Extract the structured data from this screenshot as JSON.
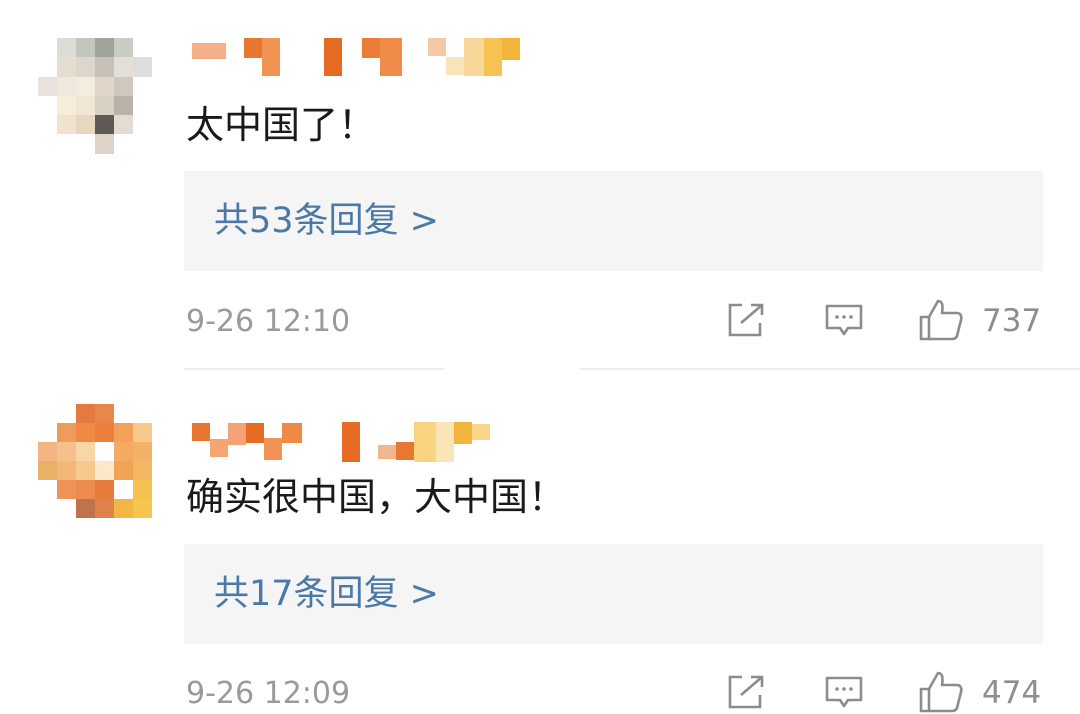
{
  "comments": [
    {
      "avatar_icon": "pixelated-avatar",
      "username_icon": "pixelated-username",
      "text": "太中国了！",
      "replies_label": "共53条回复 >",
      "time": "9-26 12:10",
      "likes": "737",
      "actions": [
        "share-icon",
        "comment-icon",
        "like-icon"
      ]
    },
    {
      "avatar_icon": "pixelated-avatar",
      "username_icon": "pixelated-username",
      "text": "确实很中国，大中国！",
      "replies_label": "共17条回复 >",
      "time": "9-26 12:09",
      "likes": "474",
      "actions": [
        "share-icon",
        "comment-icon",
        "like-icon"
      ]
    }
  ],
  "colors": {
    "link": "#4a79a8",
    "reply_bg": "#f5f5f5",
    "meta": "#9a9a9a",
    "text": "#1a1a1a"
  }
}
